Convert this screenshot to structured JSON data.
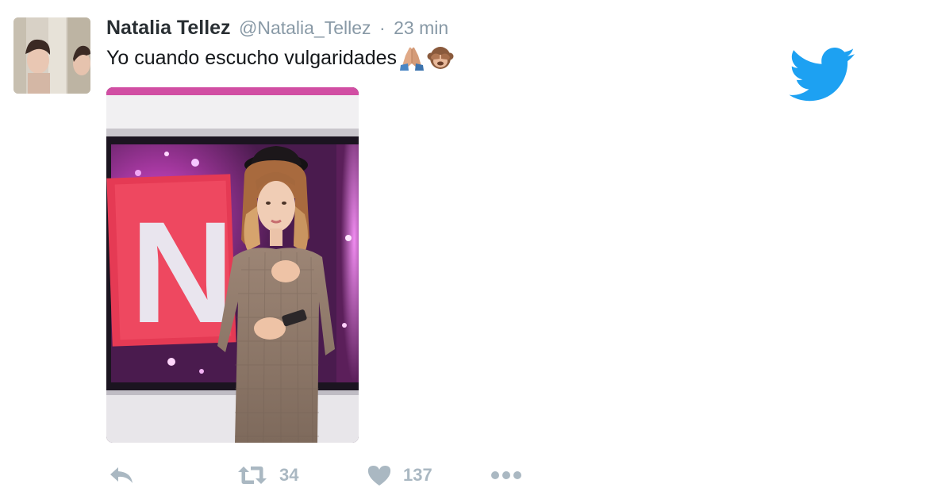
{
  "tweet": {
    "display_name": "Natalia Tellez",
    "handle": "@Natalia_Tellez",
    "separator": "·",
    "timestamp": "23 min",
    "text": "Yo cuando escucho vulgaridades",
    "emojis": [
      "folded-hands-emoji",
      "see-no-evil-monkey-emoji"
    ]
  },
  "actions": {
    "reply": {
      "icon": "reply-icon"
    },
    "retweet": {
      "icon": "retweet-icon",
      "count": "34"
    },
    "like": {
      "icon": "heart-icon",
      "count": "137"
    },
    "more": {
      "icon": "more-icon"
    }
  },
  "media_text": {
    "letter": "N"
  },
  "colors": {
    "brand_blue": "#1da1f2",
    "name_text": "#292f33",
    "meta_text": "#8899a6",
    "action_gray": "#aab8c2"
  }
}
